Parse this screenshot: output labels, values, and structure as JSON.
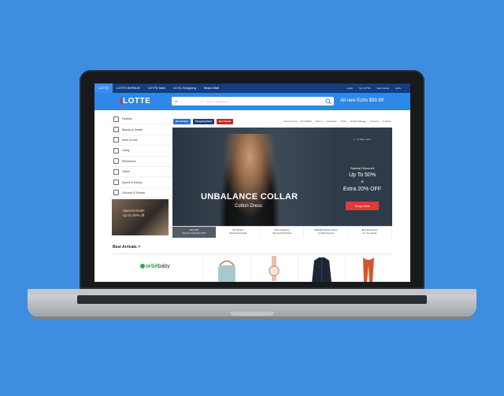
{
  "top_nav": {
    "tabs": [
      "LOTTE",
      "LOTTE AVENUE",
      "LOTTE Mart",
      "LC.KL Shopping",
      "Brand Mall"
    ],
    "active_tab": 0,
    "utility": [
      "Login",
      "My LOTTE",
      "Help Center",
      "ENG"
    ]
  },
  "header": {
    "logo": "LOTTE",
    "search_category": "All",
    "search_placeholder": "Select a Gift discount",
    "promo": "All-new Echo $99.99"
  },
  "categories": [
    {
      "label": "Fashion",
      "icon": "hanger-icon"
    },
    {
      "label": "Beauty & Health",
      "icon": "lipstick-icon"
    },
    {
      "label": "Mom & Kids",
      "icon": "baby-icon"
    },
    {
      "label": "Living",
      "icon": "sofa-icon"
    },
    {
      "label": "Electronics",
      "icon": "phone-icon"
    },
    {
      "label": "Travel",
      "icon": "plane-icon"
    },
    {
      "label": "Sports & Hobby",
      "icon": "ball-icon"
    },
    {
      "label": "Grocery & Service",
      "icon": "cart-icon"
    }
  ],
  "side_banner": {
    "text_1": "Special Deals",
    "text_2": "Up to 20% off"
  },
  "brand_row": {
    "brands": [
      "Brand Deal",
      "Shopping Deal",
      "Best Deals"
    ],
    "quick_links": [
      "Theme Story",
      "BrandMall",
      "Promo",
      "Giveaway",
      "Picks",
      "Global Mileage",
      "Voucher",
      "K-Shop"
    ]
  },
  "hero": {
    "headline": "UNBALANCE COLLAR",
    "subtitle": "Cotton Dress",
    "date": "1 ~ 8 DEC 2017",
    "special": "Special Discount",
    "line1": "Up To 50%",
    "plus": "+",
    "line2": "Extra 20% OFF",
    "cta": "Shop Now"
  },
  "banner_strip": [
    {
      "line1": "New 10th",
      "line2": "Summer Collection 2017"
    },
    {
      "line1": "This Week's",
      "line2": "Popular Demands"
    },
    {
      "line1": "Men's Deals by",
      "line2": "Ties and Cuff Links"
    },
    {
      "line1": "SEQ365 Fashion Week",
      "line2": "at Kelfin Avenue"
    },
    {
      "line1": "Best Electronics",
      "line2": "for Your House"
    }
  ],
  "best_arrivals": {
    "title": "Best Arrivals",
    "chevron": ">",
    "brand": "orbit",
    "brand_suffix": "baby"
  },
  "colors": {
    "accent": "#2e88ea",
    "nav_dark": "#143e80",
    "cta_red": "#e53935",
    "background": "#3d8ee0"
  }
}
